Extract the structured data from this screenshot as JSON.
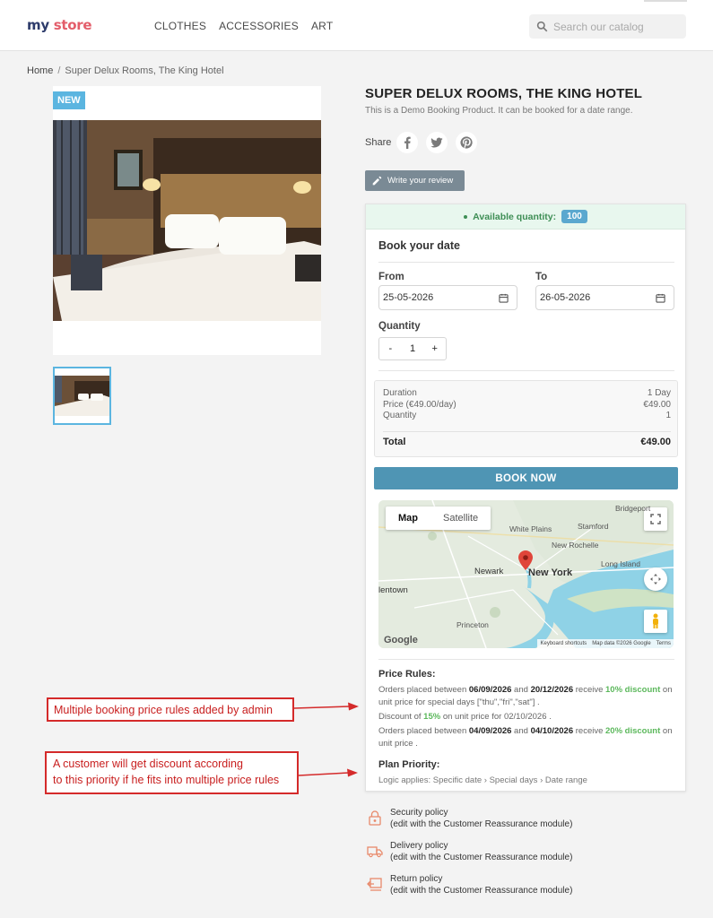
{
  "header": {
    "logo": {
      "part1": "my ",
      "part2": "store"
    },
    "nav": [
      "CLOTHES",
      "ACCESSORIES",
      "ART"
    ],
    "search_placeholder": "Search our catalog"
  },
  "breadcrumb": {
    "home": "Home",
    "separator": "/",
    "current": "Super Delux Rooms, The King Hotel"
  },
  "product": {
    "badge": "NEW",
    "title": "SUPER DELUX ROOMS, THE KING HOTEL",
    "subtitle": "This is a Demo Booking Product. It can be booked for a date range.",
    "share_label": "Share",
    "share_icons": [
      "facebook-icon",
      "twitter-icon",
      "pinterest-icon"
    ],
    "review_button": "Write your review"
  },
  "booking": {
    "available_label": "Available quantity:",
    "available_qty": "100",
    "title": "Book your date",
    "from_label": "From",
    "from_value": "25-05-2026",
    "to_label": "To",
    "to_value": "26-05-2026",
    "quantity_label": "Quantity",
    "quantity_minus": "-",
    "quantity_value": "1",
    "quantity_plus": "+",
    "summary": {
      "duration_label": "Duration",
      "duration_value": "1 Day",
      "price_label": "Price (€49.00/day)",
      "price_value": "€49.00",
      "quantity_label": "Quantity",
      "quantity_value": "1",
      "total_label": "Total",
      "total_value": "€49.00"
    },
    "book_now": "BOOK NOW"
  },
  "map": {
    "tab_map": "Map",
    "tab_satellite": "Satellite",
    "cities": {
      "new_york": "New York",
      "newark": "Newark",
      "allentown": "lentown",
      "princeton": "Princeton",
      "white_plains": "White Plains",
      "new_rochelle": "New Rochelle",
      "stamford": "Stamford",
      "bridgeport": "Bridgeport",
      "long_island": "Long Island"
    },
    "google": "Google",
    "footer": {
      "shortcuts": "Keyboard shortcuts",
      "data": "Map data ©2026 Google",
      "terms": "Terms"
    }
  },
  "price_rules": {
    "title": "Price Rules:",
    "rule1": {
      "p1": "Orders placed between ",
      "d1": "06/09/2026",
      "p2": " and ",
      "d2": "20/12/2026",
      "p3": " receive ",
      "disc": "10% discount",
      "p4": " on unit price for special days [\"thu\",\"fri\",\"sat\"] ."
    },
    "rule2": {
      "p1": "Discount of ",
      "disc": "15%",
      "p2": " on unit price for 02/10/2026 ."
    },
    "rule3": {
      "p1": "Orders placed between ",
      "d1": "04/09/2026",
      "p2": " and ",
      "d2": "04/10/2026",
      "p3": " receive ",
      "disc": "20% discount",
      "p4": " on unit price ."
    },
    "priority_title": "Plan Priority:",
    "logic": "Logic applies: Specific date › Special days › Date range"
  },
  "annotations": {
    "a1": "Multiple booking price rules added by admin",
    "a2_line1": "A customer will get discount according",
    "a2_line2": "to this priority if he fits into multiple price rules"
  },
  "reassurance": [
    {
      "title": "Security policy",
      "sub": "(edit with the Customer Reassurance module)"
    },
    {
      "title": "Delivery policy",
      "sub": "(edit with the Customer Reassurance module)"
    },
    {
      "title": "Return policy",
      "sub": "(edit with the Customer Reassurance module)"
    }
  ]
}
